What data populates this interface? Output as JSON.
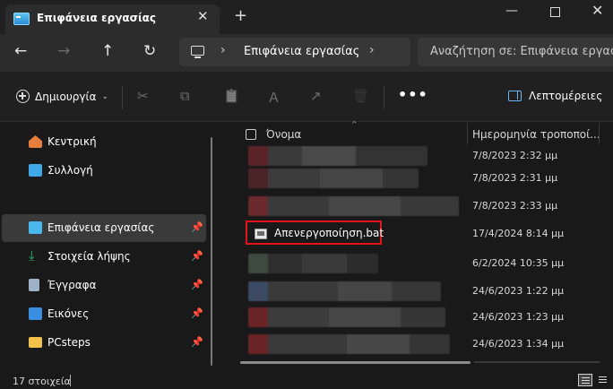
{
  "window": {
    "tab_title": "Επιφάνεια εργασίας",
    "tab_close": "✕",
    "new_tab": "+",
    "minimize": "—",
    "close": "✕"
  },
  "nav": {
    "back": "←",
    "forward": "→",
    "up": "↑",
    "refresh": "↻"
  },
  "address": {
    "separator": "›",
    "crumb": "Επιφάνεια εργασίας",
    "trailing_separator": "›"
  },
  "search": {
    "placeholder": "Αναζήτηση σε: Επιφάνεια εργασί"
  },
  "toolbar": {
    "new_label": "Δημιουργία",
    "new_chevron": "⌄",
    "cut_icon": "✂",
    "copy_icon": "⧉",
    "paste_icon": "📋",
    "rename_icon": "Ａ",
    "share_icon": "↗",
    "delete_icon": "🗑",
    "more": "•••",
    "details_label": "Λεπτομέρειες"
  },
  "sidebar": {
    "items": [
      {
        "label": "Κεντρική",
        "icon": "home-icon",
        "color": "#e87e3b",
        "pinned": false,
        "selected": false
      },
      {
        "label": "Συλλογή",
        "icon": "gallery-icon",
        "color": "#3fa9e8",
        "pinned": false,
        "selected": false
      },
      {
        "label": "Επιφάνεια εργασίας",
        "icon": "desktop-icon",
        "color": "#4ab8ee",
        "pinned": true,
        "selected": true
      },
      {
        "label": "Στοιχεία λήψης",
        "icon": "download-icon",
        "color": "#2bb673",
        "pinned": true,
        "selected": false
      },
      {
        "label": "Έγγραφα",
        "icon": "document-icon",
        "color": "#9fb3c8",
        "pinned": true,
        "selected": false
      },
      {
        "label": "Εικόνες",
        "icon": "pictures-icon",
        "color": "#3a8ee0",
        "pinned": true,
        "selected": false
      },
      {
        "label": "PCsteps",
        "icon": "folder-icon",
        "color": "#f2c24a",
        "pinned": true,
        "selected": false
      }
    ],
    "pin_glyph": "📌"
  },
  "file_list": {
    "columns": {
      "name": "Όνομα",
      "date": "Ημερομηνία τροποποί..."
    },
    "sort_glyph": "^",
    "rows": [
      {
        "name": "",
        "date": "7/8/2023 2:32 μμ",
        "blurred": true
      },
      {
        "name": "",
        "date": "7/8/2023 2:31 μμ",
        "blurred": true
      },
      {
        "name": "",
        "date": "7/8/2023 2:33 μμ",
        "blurred": true
      },
      {
        "name": "Απενεργοποίηση.bat",
        "date": "17/4/2024 8:14 μμ",
        "blurred": false,
        "highlighted": true
      },
      {
        "name": "",
        "date": "6/2/2024 10:35 μμ",
        "blurred": true
      },
      {
        "name": "",
        "date": "24/6/2023 1:22 μμ",
        "blurred": true
      },
      {
        "name": "",
        "date": "24/6/2023 1:23 μμ",
        "blurred": true
      },
      {
        "name": "",
        "date": "24/6/2023 1:34 μμ",
        "blurred": true
      }
    ],
    "highlight_color": "#e2141b"
  },
  "status": {
    "item_count": "17 στοιχεία"
  }
}
